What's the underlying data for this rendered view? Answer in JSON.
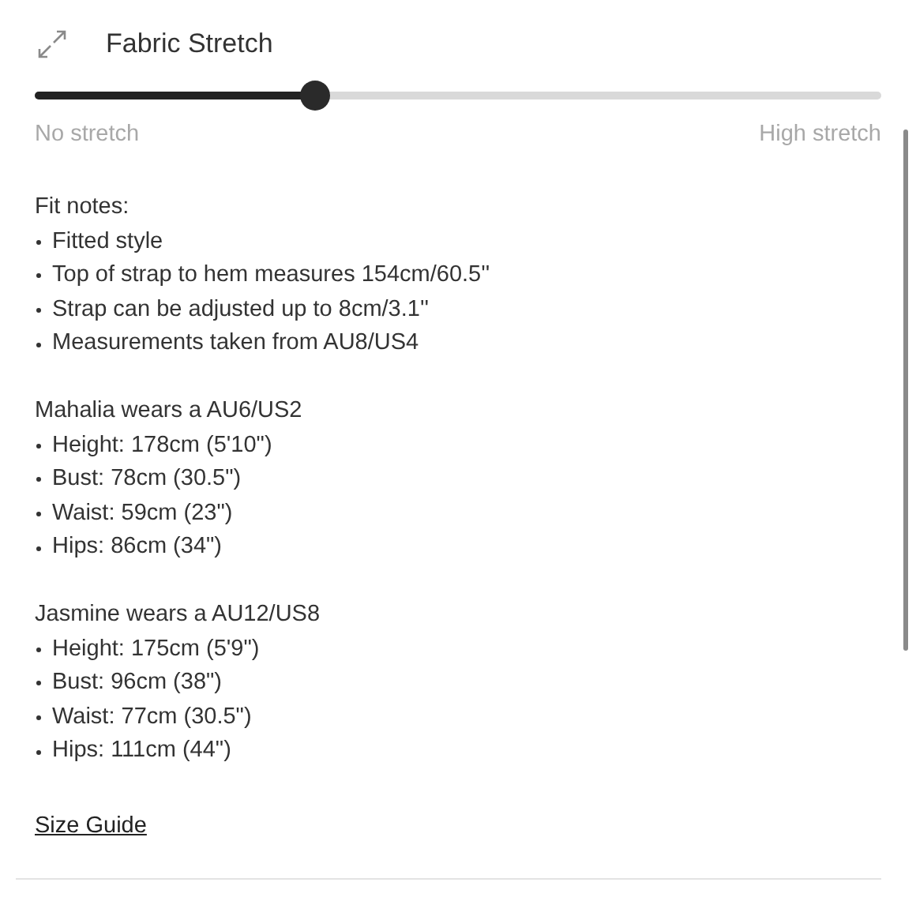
{
  "header": {
    "title": "Fabric Stretch"
  },
  "slider": {
    "level": 0.33,
    "min_label": "No stretch",
    "max_label": "High stretch"
  },
  "sections": [
    {
      "heading": "Fit notes:",
      "items": [
        "Fitted style",
        "Top of strap to hem measures 154cm/60.5''",
        "Strap can be adjusted up to 8cm/3.1''",
        "Measurements taken from AU8/US4"
      ]
    },
    {
      "heading": "Mahalia wears a AU6/US2",
      "items": [
        "Height: 178cm (5'10\")",
        "Bust: 78cm (30.5\")",
        "Waist: 59cm (23\")",
        "Hips: 86cm (34\")"
      ]
    },
    {
      "heading": "Jasmine wears a AU12/US8",
      "items": [
        "Height: 175cm (5'9\")",
        "Bust: 96cm (38\")",
        "Waist: 77cm (30.5\")",
        "Hips: 111cm (44\")"
      ]
    }
  ],
  "link": "Size Guide"
}
